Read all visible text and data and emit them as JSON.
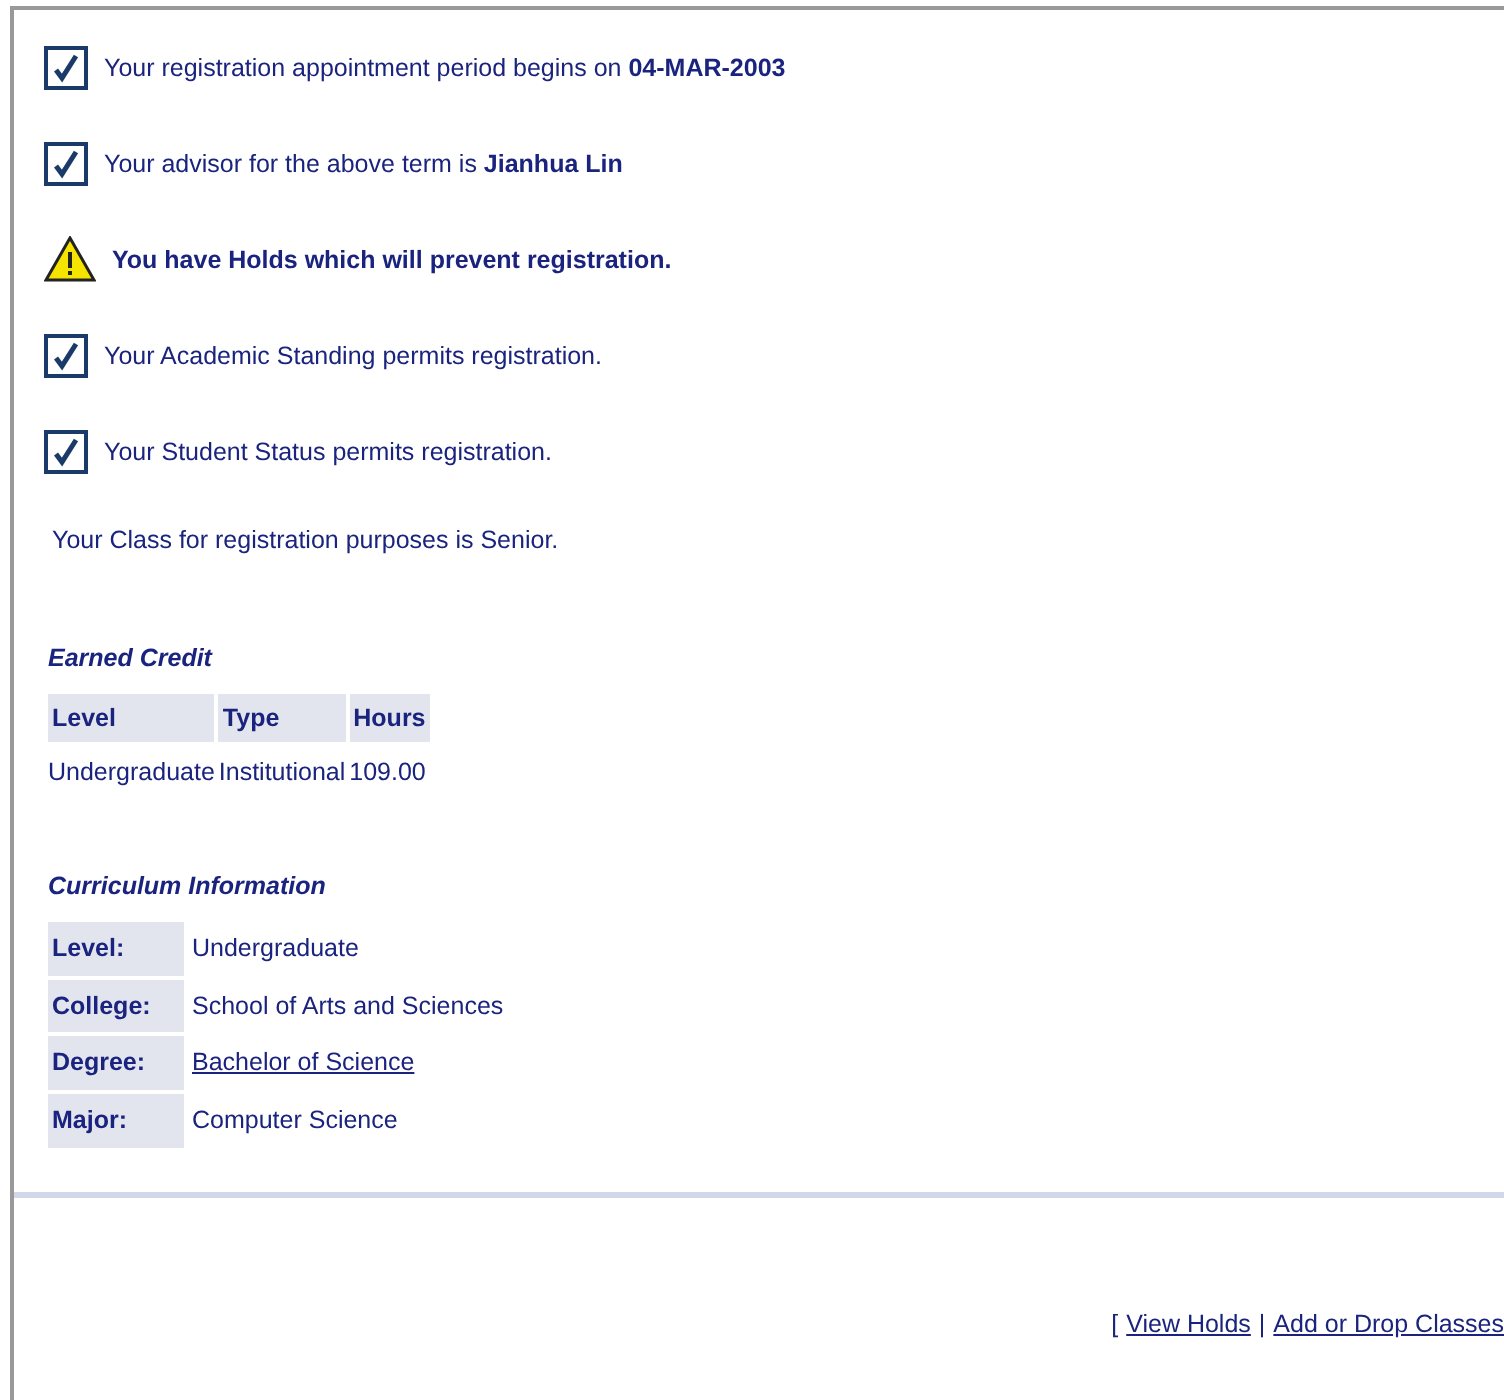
{
  "status_items": [
    {
      "kind": "ok",
      "text": "Your registration appointment period begins on **04-MAR-2003**"
    },
    {
      "kind": "ok",
      "text": "Your advisor for the above term is **Jianhua Lin**"
    },
    {
      "kind": "warning",
      "text": "**You have Holds which will prevent registration.**"
    },
    {
      "kind": "ok",
      "text": "Your Academic Standing permits registration."
    },
    {
      "kind": "ok",
      "text": "Your Student Status permits registration."
    }
  ],
  "class_note": "Your Class for registration purposes is Senior.",
  "earned_credit": {
    "title": "Earned Credit",
    "columns": [
      "Level",
      "Type",
      "Hours"
    ],
    "rows": [
      [
        "Undergraduate",
        "Institutional",
        "109.00"
      ]
    ]
  },
  "curriculum": {
    "title": "Curriculum Information",
    "rows": [
      {
        "label": "Level:",
        "value": "Undergraduate",
        "link": false
      },
      {
        "label": "College:",
        "value": "School of Arts and Sciences",
        "link": false
      },
      {
        "label": "Degree:",
        "value": "Bachelor of Science",
        "link": true
      },
      {
        "label": "Major:",
        "value": "Computer Science",
        "link": false
      }
    ]
  },
  "footer": {
    "open": "[",
    "links": [
      "View Holds",
      "Add or Drop Classes"
    ],
    "separator": "|"
  }
}
